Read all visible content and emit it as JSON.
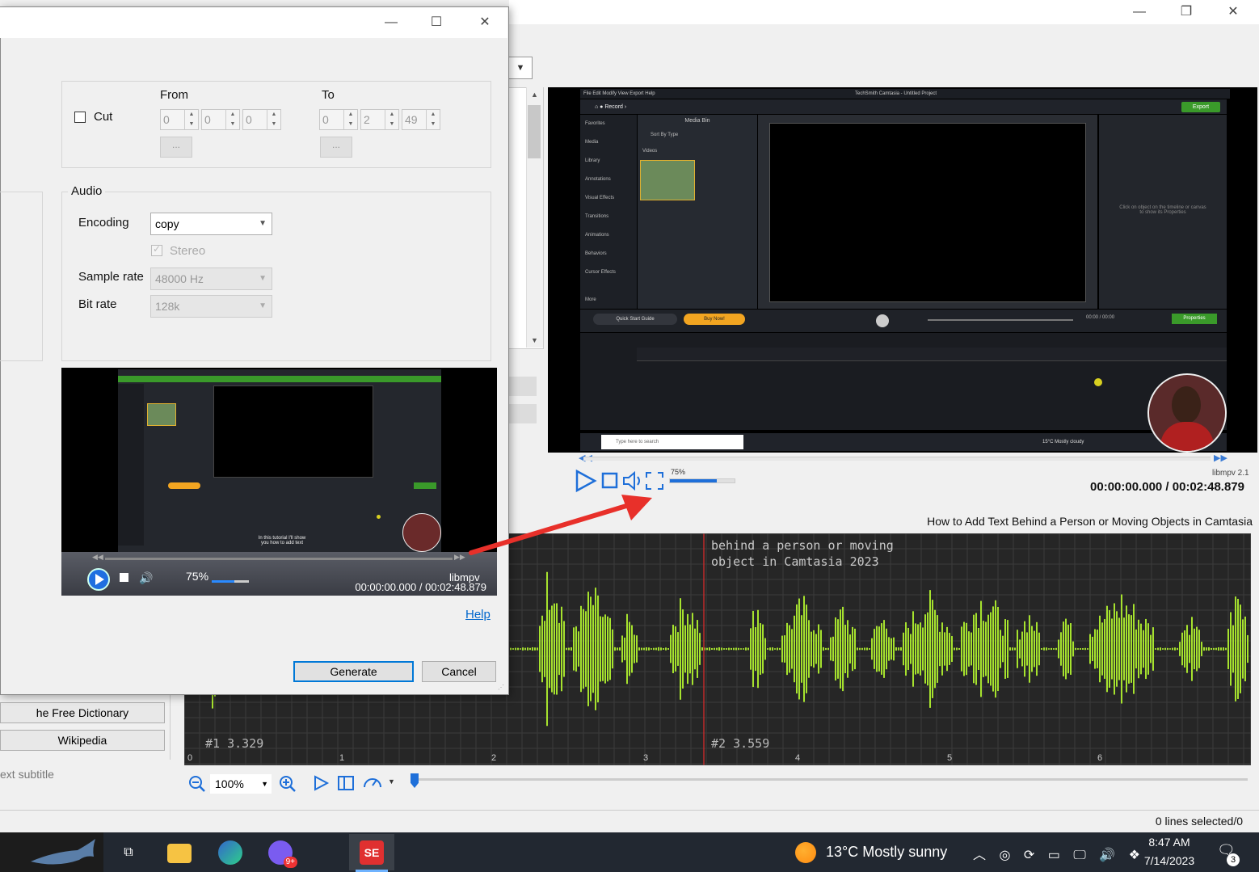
{
  "main_window": {
    "minimize": "—",
    "restore": "❐",
    "close": "✕"
  },
  "video_player": {
    "volume_label": "75%",
    "engine": "libmpv 2.1",
    "timecode": "00:00:00.000 / 00:02:48.879",
    "subtitle_title": "How to Add Text Behind a Person or Moving Objects in Camtasia"
  },
  "camtasia": {
    "menu": "File  Edit  Modify  View  Export  Help",
    "title": "TechSmith Camtasia - Untitled Project",
    "record": "Record",
    "export": "Export",
    "media_bin": "Media Bin",
    "sort_by": "Sort By  Type",
    "videos": "Videos",
    "sidebar": [
      "Favorites",
      "Media",
      "Library",
      "Annotations",
      "Visual Effects",
      "Transitions",
      "Animations",
      "Behaviors",
      "Cursor Effects"
    ],
    "more": "More",
    "properties_hint": "Click on object on the timeline or canvas to show its Properties",
    "quick_start": "Quick Start Guide",
    "buy_now": "Buy Now!",
    "properties_btn": "Properties",
    "search": "Type here to search",
    "weather": "15°C  Mostly cloudy",
    "time": "00:00 / 00:00"
  },
  "waveform": {
    "subtitle_text_line1": "behind a person or moving",
    "subtitle_text_line2": "object in Camtasia 2023",
    "segment1": "#1  3.329",
    "segment2": "#2  3.559",
    "ticks": [
      "0",
      "1",
      "2",
      "3",
      "4",
      "5",
      "6"
    ],
    "zoom": "100%"
  },
  "left_panel": {
    "free_dictionary": "he Free Dictionary",
    "wikipedia": "Wikipedia",
    "next_subtitle": "ext subtitle"
  },
  "status": {
    "lines_selected": "0 lines selected/0"
  },
  "dialog": {
    "cut_label": "Cut",
    "cut_checked": false,
    "from_label": "From",
    "to_label": "To",
    "from_values": [
      "0",
      "0",
      "0"
    ],
    "to_values": [
      "0",
      "2",
      "49"
    ],
    "dots": "...",
    "audio_group": "Audio",
    "encoding_label": "Encoding",
    "encoding_value": "copy",
    "stereo_label": "Stereo",
    "sample_rate_label": "Sample rate",
    "sample_rate_value": "48000 Hz",
    "bit_rate_label": "Bit rate",
    "bit_rate_value": "128k",
    "preview_volume": "75%",
    "preview_timecode": "00:00:00.000 / 00:02:48.879",
    "preview_engine": "libmpv",
    "preview_caption_1": "In this tutorial I'll show",
    "preview_caption_2": "you how to add text",
    "help": "Help",
    "generate": "Generate",
    "cancel": "Cancel",
    "minimize": "—",
    "maximize": "☐",
    "close": "✕"
  },
  "taskbar": {
    "weather": "13°C  Mostly sunny",
    "time": "8:47 AM",
    "date": "7/14/2023",
    "notifications": "3",
    "discord_badge": "9+",
    "apps": [
      "task-view",
      "file-explorer",
      "edge",
      "discord",
      "subtitle-edit"
    ]
  }
}
